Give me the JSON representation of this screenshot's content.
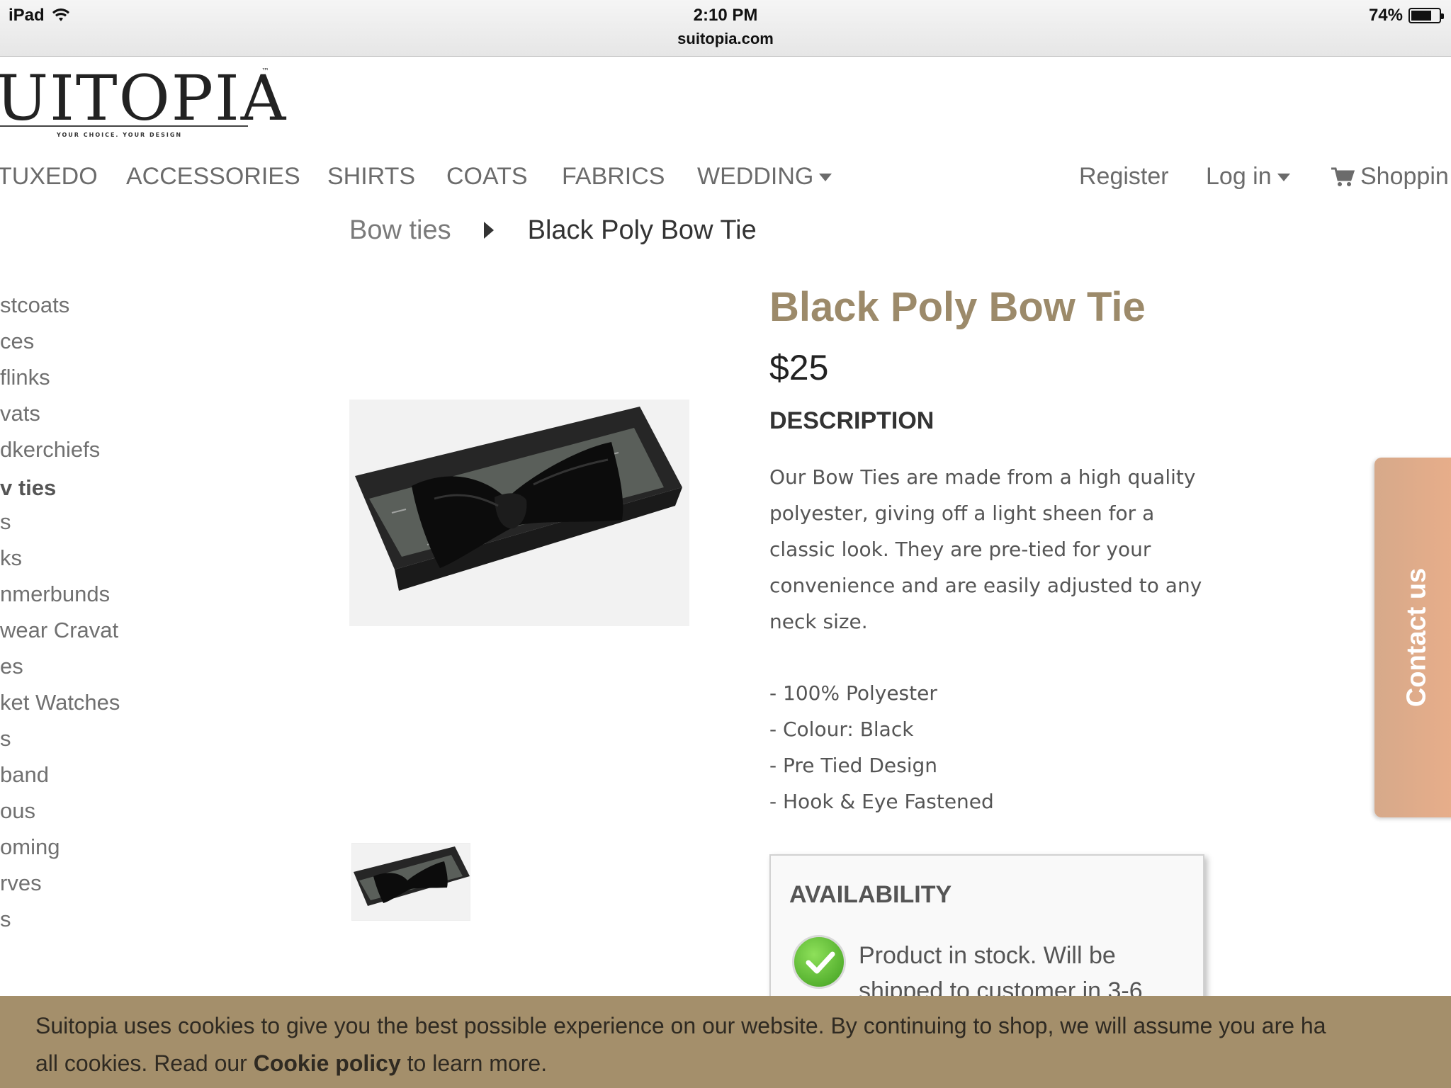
{
  "statusbar": {
    "device": "iPad",
    "time": "2:10 PM",
    "url": "suitopia.com",
    "battery": "74%",
    "battery_level": 0.74
  },
  "logo": {
    "word": "UITOPIA",
    "tagline": "YOUR CHOICE. YOUR DESIGN",
    "tm": "™"
  },
  "nav": {
    "items": [
      "TUXEDO",
      "ACCESSORIES",
      "SHIRTS",
      "COATS",
      "FABRICS",
      "WEDDING"
    ],
    "register": "Register",
    "login": "Log in",
    "shopping": "Shoppin"
  },
  "breadcrumb": {
    "parent": "Bow ties",
    "current": "Black Poly Bow Tie"
  },
  "sidebar": {
    "items": [
      "stcoats",
      "ces",
      "flinks",
      "vats",
      "dkerchiefs",
      "v ties",
      "s",
      "ks",
      "nmerbunds",
      "wear Cravat",
      "es",
      "ket Watches",
      "s",
      "band",
      "ous",
      "oming",
      "rves",
      "s"
    ],
    "active_index": 5
  },
  "product": {
    "title": "Black Poly Bow Tie",
    "price": "$25",
    "description_heading": "DESCRIPTION",
    "description_lines": [
      "Our Bow Ties are made from a high quality",
      "polyester, giving off a light sheen for a",
      "classic look. They are pre-tied for your",
      "convenience and are easily adjusted to any",
      "neck size."
    ],
    "bullets": [
      "- 100% Polyester",
      "- Colour: Black",
      "- Pre Tied Design",
      "- Hook & Eye Fastened"
    ],
    "availability_heading": "AVAILABILITY",
    "availability_lines": [
      "Product in stock. Will be",
      "shipped to customer in 3-6"
    ]
  },
  "contact": {
    "label": "Contact us"
  },
  "cookie": {
    "line1": "Suitopia uses cookies to give you the best possible experience on our website. By continuing to shop, we will assume you are ha",
    "line2_before": "all cookies. Read our ",
    "policy_link": "Cookie policy",
    "line2_after": " to learn more."
  },
  "colors": {
    "brand_title": "#9c8a6a",
    "cookie_bg": "#a48f6b",
    "contact_tab": "#e3ab8a",
    "stock_green": "#4cae2a"
  }
}
